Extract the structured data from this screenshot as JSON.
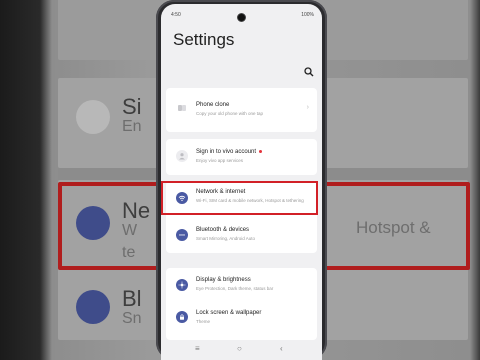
{
  "status_bar": {
    "time": "4:50",
    "battery": "100%"
  },
  "page_title": "Settings",
  "icons": {
    "search": "search-icon",
    "phone_clone": "phone-clone-icon",
    "account": "account-icon",
    "network": "wifi-icon",
    "bluetooth": "bluetooth-icon",
    "display": "brightness-icon",
    "lock": "lock-icon"
  },
  "items": [
    {
      "title": "Phone clone",
      "subtitle": "Copy your old phone with one tap"
    },
    {
      "title": "Sign in to vivo account",
      "subtitle": "Enjoy vivo app services"
    },
    {
      "title": "Network & internet",
      "subtitle": "Wi-Fi, SIM card & mobile network, Hotspot & tethering"
    },
    {
      "title": "Bluetooth & devices",
      "subtitle": "Smart Mirroring, Android Auto"
    },
    {
      "title": "Display & brightness",
      "subtitle": "Eye Protection, Dark theme, status bar"
    },
    {
      "title": "Lock screen & wallpaper",
      "subtitle": "Theme"
    }
  ],
  "background_zoom": {
    "line1": "Si",
    "line1_sub": "En",
    "line2": "Ne",
    "line2_sub": "W",
    "line2_right": "Hotspot &",
    "line2_right_sub": "te",
    "line3": "Bl",
    "line3_sub": "Sn"
  },
  "colors": {
    "accent_icon": "#4a5aa3",
    "highlight": "#d22027",
    "notification_dot": "#e4333b"
  }
}
